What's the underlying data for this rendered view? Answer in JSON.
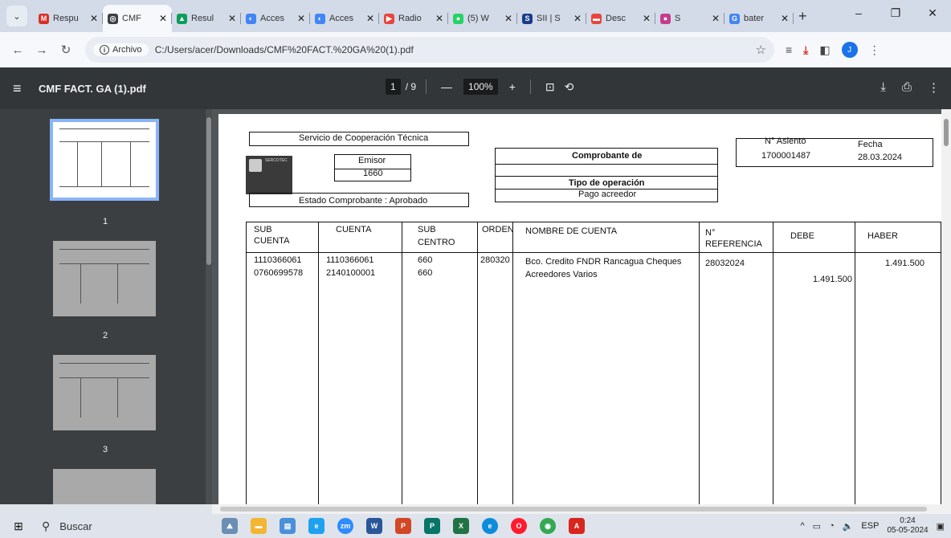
{
  "browser": {
    "tabs": [
      {
        "label": "Respu",
        "color": "#d93025",
        "glyph": "M"
      },
      {
        "label": "CMF",
        "color": "#3c4043",
        "glyph": "◎",
        "active": true
      },
      {
        "label": "Resul",
        "color": "#0f9d58",
        "glyph": "▲"
      },
      {
        "label": "Acces",
        "color": "#4285f4",
        "glyph": "◐"
      },
      {
        "label": "Acces",
        "color": "#4285f4",
        "glyph": "◐"
      },
      {
        "label": "Radio",
        "color": "#e8453c",
        "glyph": "▶"
      },
      {
        "label": "(5) W",
        "color": "#25d366",
        "glyph": "●"
      },
      {
        "label": "SII | S",
        "color": "#1a3c8a",
        "glyph": "S"
      },
      {
        "label": "Desc",
        "color": "#e8453c",
        "glyph": "▬"
      },
      {
        "label": "S",
        "color": "#c43c8c",
        "glyph": "●"
      },
      {
        "label": "bater",
        "color": "#4285f4",
        "glyph": "G"
      }
    ],
    "origin_chip": "Archivo",
    "url": "C:/Users/acer/Downloads/CMF%20FACT.%20GA%20(1).pdf",
    "profile_initial": "J"
  },
  "pdf": {
    "title": "CMF FACT. GA (1).pdf",
    "current_page": "1",
    "total_pages": "/ 9",
    "zoom": "100%"
  },
  "thumbnails": [
    {
      "label": "1"
    },
    {
      "label": "2"
    },
    {
      "label": "3"
    }
  ],
  "document": {
    "header_box_top": "Servicio de Cooperación Técnica",
    "emisor_label": "Emisor",
    "emisor_value": "1660",
    "estado": "Estado Comprobante : Aprobado",
    "comprobante_label": "Comprobante de",
    "tipo_label": "Tipo de operación",
    "tipo_value": "Pago acreedor",
    "asiento_label": "N° Asiento",
    "asiento_value": "1700001487",
    "fecha_label": "Fecha",
    "fecha_value": "28.03.2024",
    "seal_text": "SERCOTEC",
    "columns": {
      "sub_cuenta_1": "SUB",
      "sub_cuenta_2": "CUENTA",
      "cuenta": "CUENTA",
      "sub_centro_1": "SUB",
      "sub_centro_2": "CENTRO",
      "orden": "ORDEN",
      "nombre": "NOMBRE DE CUENTA",
      "ref_1": "N°",
      "ref_2": "REFERENCIA",
      "debe": "DEBE",
      "haber": "HABER"
    },
    "rows": [
      {
        "sub_cuenta": "1110366061",
        "cuenta": "1110366061",
        "sub_centro": "660",
        "orden": "280320",
        "nombre": "Bco. Credito FNDR Rancagua Cheques",
        "referencia": "28032024",
        "debe": "",
        "haber": "1.491.500"
      },
      {
        "sub_cuenta": "0760699578",
        "cuenta": "2140100001",
        "sub_centro": "660",
        "orden": "",
        "nombre": "Acreedores Varios",
        "referencia": "",
        "debe": "1.491.500",
        "haber": ""
      }
    ]
  },
  "taskbar": {
    "search_label": "Buscar",
    "lang": "ESP",
    "time": "0:24",
    "date": "05-05-2024"
  }
}
